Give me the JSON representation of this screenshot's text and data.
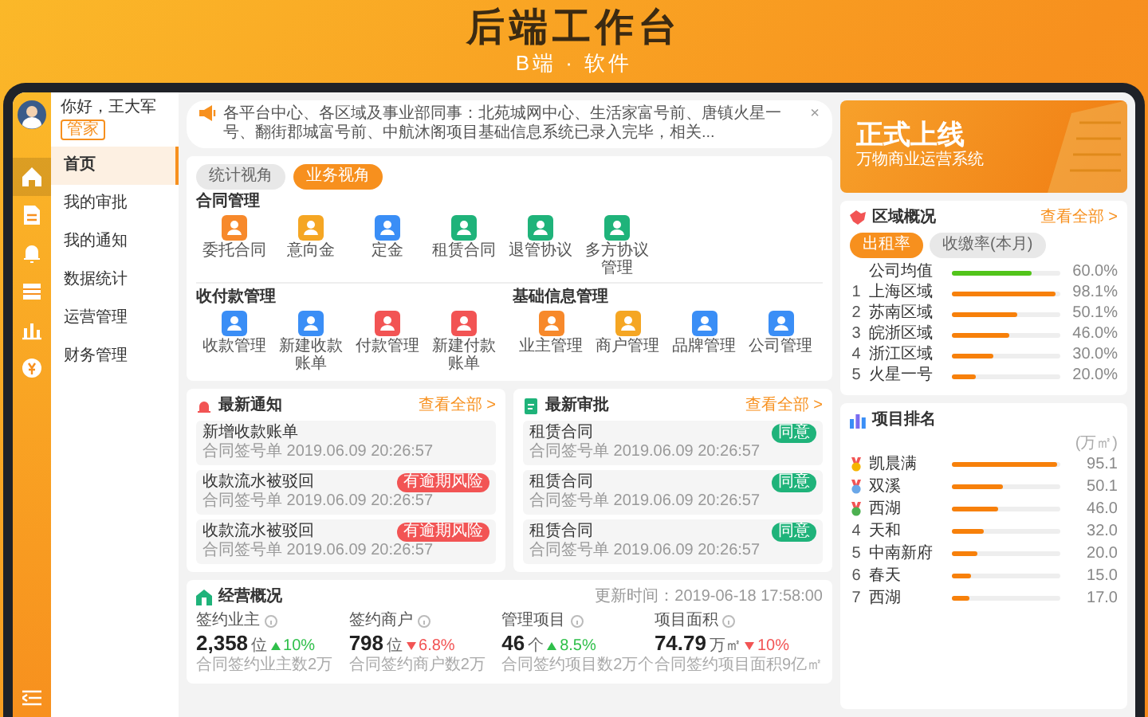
{
  "headline": {
    "title": "后端工作台",
    "subtitle": "B端 · 软件"
  },
  "sidebar": {
    "greeting": "你好，王大军",
    "role": "管家",
    "items": [
      {
        "label": "首页",
        "selected": true
      },
      {
        "label": "我的审批",
        "selected": false
      },
      {
        "label": "我的通知",
        "selected": false
      },
      {
        "label": "数据统计",
        "selected": false
      },
      {
        "label": "运营管理",
        "selected": false
      },
      {
        "label": "财务管理",
        "selected": false
      }
    ]
  },
  "notice": {
    "text": "各平台中心、各区域及事业部同事：北苑城网中心、生活家富号前、唐镇火星一号、翻街郡城富号前、中航沐阁项目基础信息系统已录入完毕，相关...",
    "close": "×"
  },
  "view_tabs": [
    {
      "label": "统计视角",
      "selected": false
    },
    {
      "label": "业务视角",
      "selected": true
    }
  ],
  "app_groups": [
    {
      "title": "合同管理",
      "apps": [
        {
          "label": "委托合同",
          "color": "#f7892b"
        },
        {
          "label": "意向金",
          "color": "#f5a623"
        },
        {
          "label": "定金",
          "color": "#3a8ef6"
        },
        {
          "label": "租赁合同",
          "color": "#1fb37a"
        },
        {
          "label": "退管协议",
          "color": "#1fb37a"
        },
        {
          "label": "多方协议管理",
          "color": "#1fb37a"
        }
      ]
    },
    {
      "title": "收付款管理",
      "apps": [
        {
          "label": "收款管理",
          "color": "#3a8ef6"
        },
        {
          "label": "新建收款账单",
          "color": "#3a8ef6"
        },
        {
          "label": "付款管理",
          "color": "#f25454"
        },
        {
          "label": "新建付款账单",
          "color": "#f25454"
        }
      ]
    },
    {
      "title": "基础信息管理",
      "apps": [
        {
          "label": "业主管理",
          "color": "#f7892b"
        },
        {
          "label": "商户管理",
          "color": "#f5a623"
        },
        {
          "label": "品牌管理",
          "color": "#3a8ef6"
        },
        {
          "label": "公司管理",
          "color": "#3a8ef6"
        }
      ]
    }
  ],
  "notifications": {
    "title": "最新通知",
    "more": "查看全部 >",
    "items": [
      {
        "title": "新增收款账单",
        "meta": "合同签号单 2019.06.09 20:26:57"
      },
      {
        "title": "收款流水被驳回",
        "meta": "合同签号单 2019.06.09 20:26:57",
        "badge": "有逾期风险"
      },
      {
        "title": "收款流水被驳回",
        "meta": "合同签号单 2019.06.09 20:26:57",
        "badge": "有逾期风险"
      }
    ]
  },
  "approvals": {
    "title": "最新审批",
    "more": "查看全部 >",
    "items": [
      {
        "title": "租赁合同",
        "meta": "合同签号单 2019.06.09 20:26:57",
        "badge": "同意"
      },
      {
        "title": "租赁合同",
        "meta": "合同签号单 2019.06.09 20:26:57",
        "badge": "同意"
      },
      {
        "title": "租赁合同",
        "meta": "合同签号单 2019.06.09 20:26:57",
        "badge": "同意"
      }
    ]
  },
  "overview": {
    "title": "经营概况",
    "updated": "更新时间：2019-06-18 17:58:00",
    "stats": [
      {
        "label": "签约业主",
        "value": "2,358",
        "unit": "位",
        "rising": true,
        "change": "10%",
        "note": "合同签约业主数2万"
      },
      {
        "label": "签约商户",
        "value": "798",
        "unit": "位",
        "rising": false,
        "change": "6.8%",
        "note": "合同签约商户数2万"
      },
      {
        "label": "管理项目",
        "value": "46",
        "unit": "个",
        "rising": true,
        "change": "8.5%",
        "note": "合同签约项目数2万个"
      },
      {
        "label": "项目面积",
        "value": "74.79",
        "unit": "万㎡",
        "rising": false,
        "change": "10%",
        "note": "合同签约项目面积9亿㎡"
      }
    ]
  },
  "banner": {
    "title": "正式上线",
    "subtitle": "万物商业运营系统"
  },
  "regions": {
    "title": "区域概况",
    "more": "查看全部 >",
    "tabs": [
      {
        "label": "出租率",
        "selected": true
      },
      {
        "label": "收缴率(本月)",
        "selected": false
      }
    ],
    "rows": [
      {
        "name": "公司均值",
        "level": 0.73,
        "value": "60.0%",
        "color": "#52c41a"
      },
      {
        "rank": "1",
        "name": "上海区域",
        "level": 0.96,
        "value": "98.1%",
        "color": "#f7800a"
      },
      {
        "rank": "2",
        "name": "苏南区域",
        "level": 0.6,
        "value": "50.1%",
        "color": "#f7800a"
      },
      {
        "rank": "3",
        "name": "皖浙区域",
        "level": 0.53,
        "value": "46.0%",
        "color": "#f7800a"
      },
      {
        "rank": "4",
        "name": "浙江区域",
        "level": 0.38,
        "value": "30.0%",
        "color": "#f7800a"
      },
      {
        "rank": "5",
        "name": "火星一号",
        "level": 0.22,
        "value": "20.0%",
        "color": "#f7800a"
      }
    ]
  },
  "ranking": {
    "title": "项目排名",
    "unit": "(万㎡)",
    "rows": [
      {
        "kind": "medal",
        "color": "#f5b400",
        "name": "凯晨满",
        "level": 0.97,
        "value": "95.1"
      },
      {
        "kind": "medal",
        "color": "#6aa7e8",
        "name": "双溪",
        "level": 0.47,
        "value": "50.1"
      },
      {
        "kind": "medal",
        "color": "#4cb050",
        "name": "西湖",
        "level": 0.42,
        "value": "46.0"
      },
      {
        "kind": "number",
        "rank": "4",
        "name": "天和",
        "level": 0.3,
        "value": "32.0"
      },
      {
        "kind": "number",
        "rank": "5",
        "name": "中南新府",
        "level": 0.24,
        "value": "20.0"
      },
      {
        "kind": "number",
        "rank": "6",
        "name": "春天",
        "level": 0.18,
        "value": "15.0"
      },
      {
        "kind": "number",
        "rank": "7",
        "name": "西湖",
        "level": 0.16,
        "value": "17.0"
      }
    ]
  }
}
